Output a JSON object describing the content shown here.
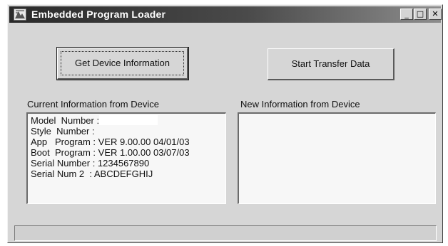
{
  "window": {
    "title": "Embedded Program Loader",
    "icon": "app-icon"
  },
  "controls": {
    "minimize": "_",
    "maximize": "□",
    "close": "✕"
  },
  "buttons": {
    "get_device_info": "Get Device Information",
    "start_transfer": "Start Transfer Data"
  },
  "current_info": {
    "label": "Current Information from Device",
    "lines": [
      "Model  Number :",
      "Style  Number :",
      "App   Program : VER 9.00.00 04/01/03",
      "Boot  Program : VER 1.00.00 03/07/03",
      "Serial Number : 1234567890",
      "Serial Num 2  : ABCDEFGHIJ"
    ]
  },
  "new_info": {
    "label": "New Information from Device",
    "lines": []
  },
  "status": {
    "text": ""
  }
}
